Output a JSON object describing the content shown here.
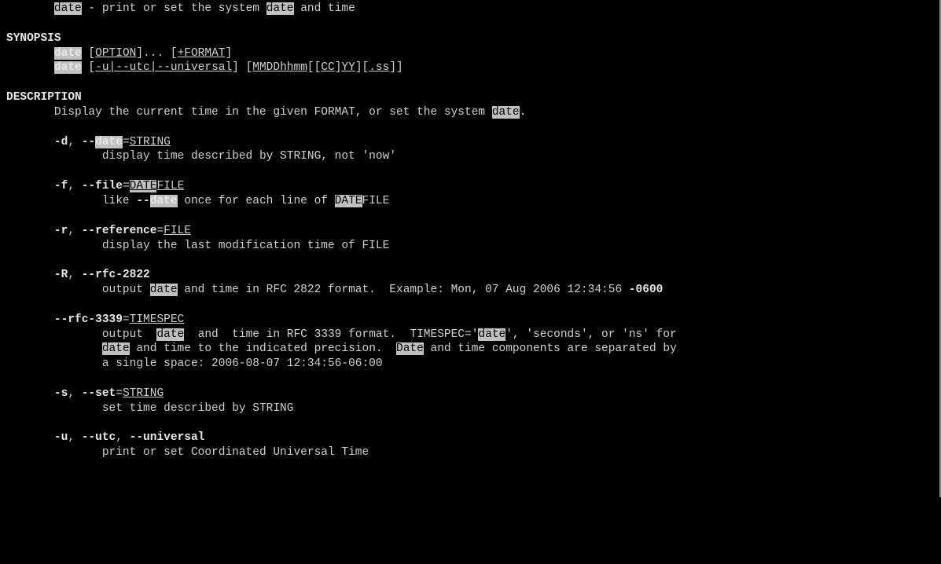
{
  "lines": [
    [
      {
        "t": "       "
      },
      {
        "t": "date",
        "hl": true
      },
      {
        "t": " - print or set the system "
      },
      {
        "t": "date",
        "hl": true
      },
      {
        "t": " and time"
      }
    ],
    [
      {
        "t": ""
      }
    ],
    [
      {
        "t": "SYNOPSIS",
        "section": true
      }
    ],
    [
      {
        "t": "       "
      },
      {
        "t": "date",
        "hl": true,
        "bold": true
      },
      {
        "t": " ["
      },
      {
        "t": "OPTION",
        "ul": true
      },
      {
        "t": "]... ["
      },
      {
        "t": "+FORMAT",
        "ul": true
      },
      {
        "t": "]"
      }
    ],
    [
      {
        "t": "       "
      },
      {
        "t": "date",
        "hl": true,
        "bold": true
      },
      {
        "t": " ["
      },
      {
        "t": "-u|--utc|--universal",
        "ul": true
      },
      {
        "t": "] ["
      },
      {
        "t": "MMDDhhmm",
        "ul": true
      },
      {
        "t": "[["
      },
      {
        "t": "CC",
        "ul": true
      },
      {
        "t": "]"
      },
      {
        "t": "YY",
        "ul": true
      },
      {
        "t": "]["
      },
      {
        "t": ".ss",
        "ul": true
      },
      {
        "t": "]]"
      }
    ],
    [
      {
        "t": ""
      }
    ],
    [
      {
        "t": "DESCRIPTION",
        "section": true
      }
    ],
    [
      {
        "t": "       Display the current time in the given FORMAT, or set the system "
      },
      {
        "t": "date",
        "hl": true
      },
      {
        "t": "."
      }
    ],
    [
      {
        "t": ""
      }
    ],
    [
      {
        "t": "       "
      },
      {
        "t": "-d",
        "bold": true
      },
      {
        "t": ", "
      },
      {
        "t": "--",
        "bold": true
      },
      {
        "t": "date",
        "hl": true,
        "bold": true
      },
      {
        "t": "="
      },
      {
        "t": "STRING",
        "ul": true
      }
    ],
    [
      {
        "t": "              display time described by STRING, not 'now'"
      }
    ],
    [
      {
        "t": ""
      }
    ],
    [
      {
        "t": "       "
      },
      {
        "t": "-f",
        "bold": true
      },
      {
        "t": ", "
      },
      {
        "t": "--file",
        "bold": true
      },
      {
        "t": "="
      },
      {
        "t": "DATE",
        "ul": true,
        "hl": true
      },
      {
        "t": "FILE",
        "ul": true
      }
    ],
    [
      {
        "t": "              like "
      },
      {
        "t": "--",
        "bold": true
      },
      {
        "t": "date",
        "hl": true,
        "bold": true
      },
      {
        "t": " once for each line of "
      },
      {
        "t": "DATE",
        "hl": true
      },
      {
        "t": "FILE"
      }
    ],
    [
      {
        "t": ""
      }
    ],
    [
      {
        "t": "       "
      },
      {
        "t": "-r",
        "bold": true
      },
      {
        "t": ", "
      },
      {
        "t": "--reference",
        "bold": true
      },
      {
        "t": "="
      },
      {
        "t": "FILE",
        "ul": true
      }
    ],
    [
      {
        "t": "              display the last modification time of FILE"
      }
    ],
    [
      {
        "t": ""
      }
    ],
    [
      {
        "t": "       "
      },
      {
        "t": "-R",
        "bold": true
      },
      {
        "t": ", "
      },
      {
        "t": "--rfc-2822",
        "bold": true
      }
    ],
    [
      {
        "t": "              output "
      },
      {
        "t": "date",
        "hl": true
      },
      {
        "t": " and time in RFC 2822 format.  Example: Mon, 07 Aug 2006 12:34:56 "
      },
      {
        "t": "-0600",
        "bold": true
      }
    ],
    [
      {
        "t": ""
      }
    ],
    [
      {
        "t": "       "
      },
      {
        "t": "--rfc-3339",
        "bold": true
      },
      {
        "t": "="
      },
      {
        "t": "TIMESPEC",
        "ul": true
      }
    ],
    [
      {
        "t": "              output  "
      },
      {
        "t": "date",
        "hl": true
      },
      {
        "t": "  and  time in RFC 3339 format.  TIMESPEC='"
      },
      {
        "t": "date",
        "hl": true
      },
      {
        "t": "', 'seconds', or 'ns' for"
      }
    ],
    [
      {
        "t": "              "
      },
      {
        "t": "date",
        "hl": true
      },
      {
        "t": " and time to the indicated precision.  "
      },
      {
        "t": "Date",
        "hl": true
      },
      {
        "t": " and time components are separated by"
      }
    ],
    [
      {
        "t": "              a single space: 2006-08-07 12:34:56-06:00"
      }
    ],
    [
      {
        "t": ""
      }
    ],
    [
      {
        "t": "       "
      },
      {
        "t": "-s",
        "bold": true
      },
      {
        "t": ", "
      },
      {
        "t": "--set",
        "bold": true
      },
      {
        "t": "="
      },
      {
        "t": "STRING",
        "ul": true
      }
    ],
    [
      {
        "t": "              set time described by STRING"
      }
    ],
    [
      {
        "t": ""
      }
    ],
    [
      {
        "t": "       "
      },
      {
        "t": "-u",
        "bold": true
      },
      {
        "t": ", "
      },
      {
        "t": "--utc",
        "bold": true
      },
      {
        "t": ", "
      },
      {
        "t": "--universal",
        "bold": true
      }
    ],
    [
      {
        "t": "              print or set Coordinated Universal Time"
      }
    ]
  ]
}
